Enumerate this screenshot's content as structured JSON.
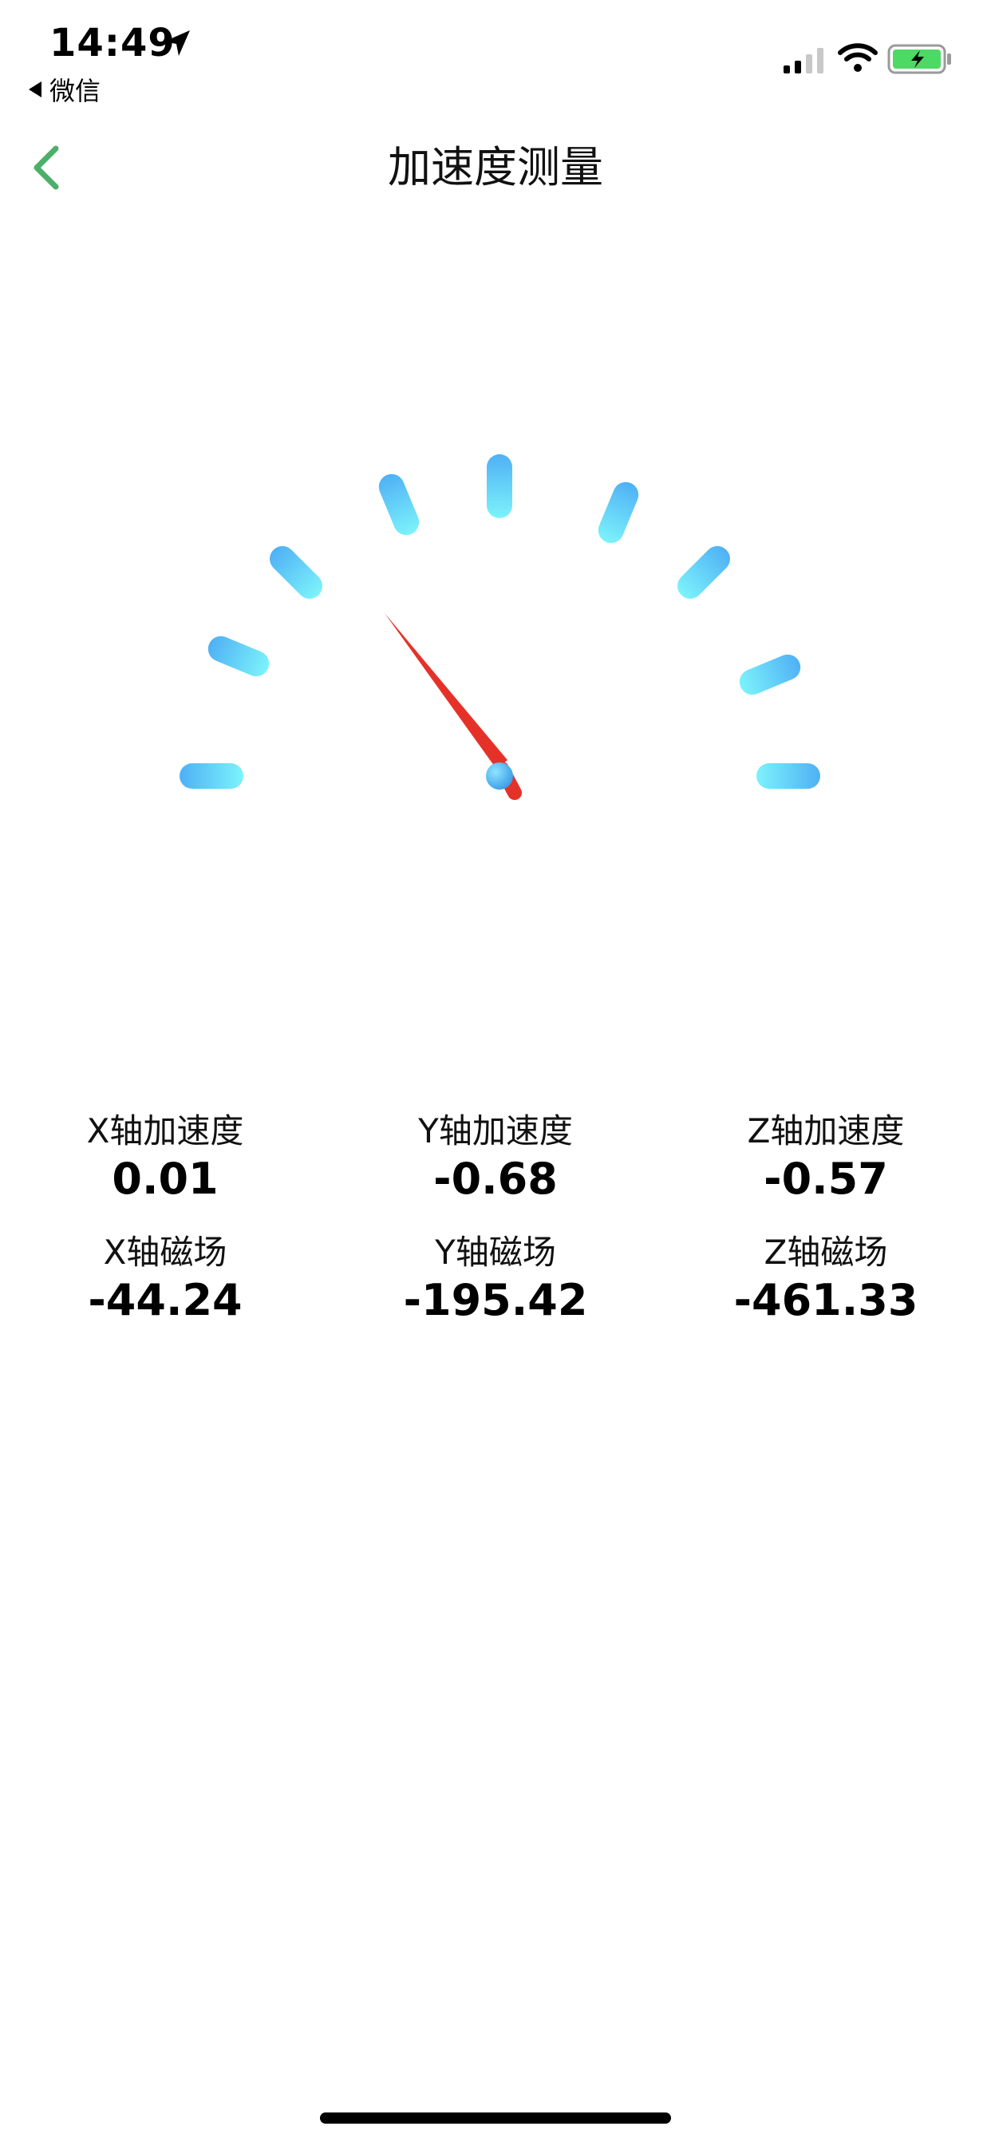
{
  "status_bar": {
    "time": "14:49",
    "back_app_label": "微信",
    "icons": [
      "location-arrow-icon",
      "cellular-signal-icon",
      "wifi-icon",
      "battery-charging-icon"
    ],
    "battery_color": "#4cd964"
  },
  "nav": {
    "title": "加速度测量",
    "back_icon": "chevron-left-icon",
    "accent_color": "#4caf6a"
  },
  "gauge": {
    "tick_count": 9,
    "tick_color_start": "#4fb0f5",
    "tick_color_end": "#7cf3fb",
    "needle_color": "#e53228",
    "needle_level": 0.2
  },
  "readings": [
    {
      "label": "X轴加速度",
      "value": "0.01"
    },
    {
      "label": "Y轴加速度",
      "value": "-0.68"
    },
    {
      "label": "Z轴加速度",
      "value": "-0.57"
    },
    {
      "label": "X轴磁场",
      "value": "-44.24"
    },
    {
      "label": "Y轴磁场",
      "value": "-195.42"
    },
    {
      "label": "Z轴磁场",
      "value": "-461.33"
    }
  ]
}
